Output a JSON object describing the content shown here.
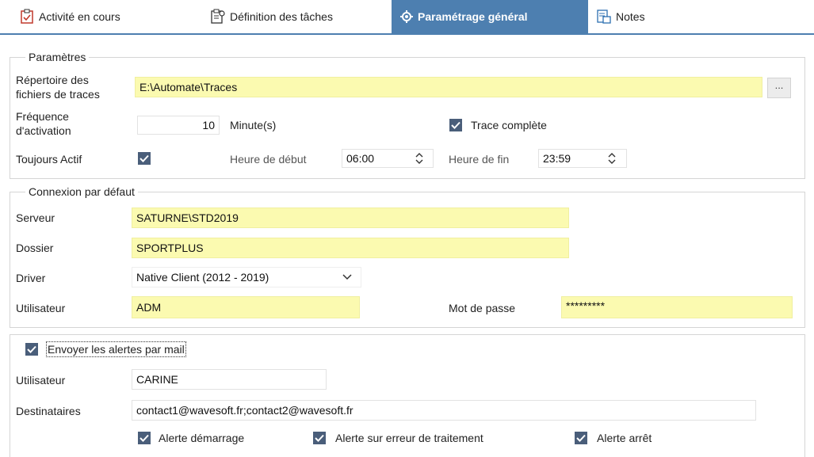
{
  "tabs": [
    {
      "label": "Activité en cours",
      "icon": "clipboard-check-icon"
    },
    {
      "label": "Définition des tâches",
      "icon": "clipboard-gear-icon"
    },
    {
      "label": "Paramétrage général",
      "icon": "gear-icon",
      "active": true
    },
    {
      "label": "Notes",
      "icon": "notes-icon"
    }
  ],
  "parametres": {
    "title": "Paramètres",
    "repertoire_label_1": "Répertoire des",
    "repertoire_label_2": "fichiers de traces",
    "repertoire_value": "E:\\Automate\\Traces",
    "browse_label": "...",
    "frequence_label_1": "Fréquence",
    "frequence_label_2": "d'activation",
    "frequence_value": "10",
    "frequence_unit": "Minute(s)",
    "trace_complete_label": "Trace complète",
    "trace_complete_checked": true,
    "toujours_actif_label": "Toujours Actif",
    "toujours_actif_checked": true,
    "heure_debut_label": "Heure de début",
    "heure_debut_value": "06:00",
    "heure_fin_label": "Heure de fin",
    "heure_fin_value": "23:59"
  },
  "connexion": {
    "title": "Connexion par défaut",
    "serveur_label": "Serveur",
    "serveur_value": "SATURNE\\STD2019",
    "dossier_label": "Dossier",
    "dossier_value": "SPORTPLUS",
    "driver_label": "Driver",
    "driver_value": "Native Client (2012 - 2019)",
    "utilisateur_label": "Utilisateur",
    "utilisateur_value": "ADM",
    "motdepasse_label": "Mot de passe",
    "motdepasse_value": "*********"
  },
  "alertes": {
    "envoyer_label": "Envoyer les alertes par mail",
    "envoyer_checked": true,
    "utilisateur_label": "Utilisateur",
    "utilisateur_value": "CARINE",
    "destinataires_label": "Destinataires",
    "destinataires_value": "contact1@wavesoft.fr;contact2@wavesoft.fr",
    "alerte_demarrage_label": "Alerte démarrage",
    "alerte_erreur_label": "Alerte sur erreur de traitement",
    "alerte_arret_label": "Alerte arrêt"
  },
  "colors": {
    "active_tab": "#4d7fb0",
    "field_highlight": "#fbfab0",
    "checkbox": "#4a5e7a"
  }
}
